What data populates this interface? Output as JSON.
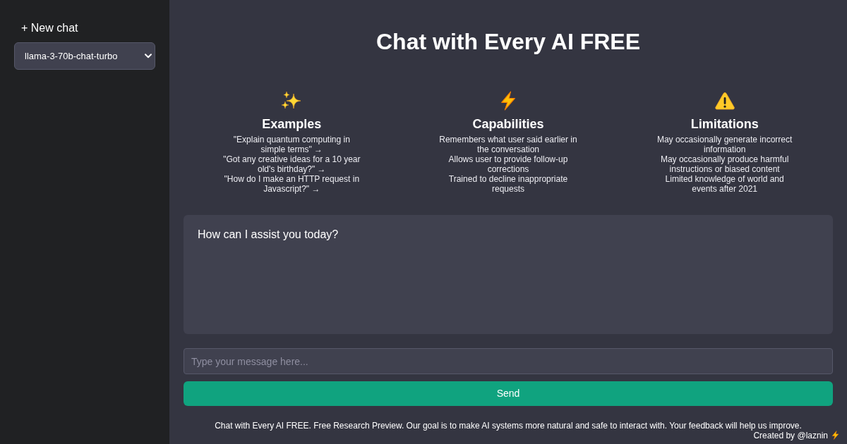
{
  "sidebar": {
    "new_chat_button": "+ New chat",
    "model_select": {
      "value": "llama-3-70b-chat-turbo"
    }
  },
  "main": {
    "title": "Chat with Every AI FREE",
    "columns": [
      {
        "kind": "sparkles",
        "heading": "Examples",
        "items": [
          "\"Explain quantum computing in simple terms\" →",
          "\"Got any creative ideas for a 10 year old's birthday?\" →",
          "\"How do I make an HTTP request in Javascript?\" →"
        ]
      },
      {
        "kind": "bolt",
        "heading": "Capabilities",
        "items": [
          "Remembers what user said earlier in the conversation",
          "Allows user to provide follow-up corrections",
          "Trained to decline inappropriate requests"
        ]
      },
      {
        "kind": "warning",
        "heading": "Limitations",
        "items": [
          "May occasionally generate incorrect information",
          "May occasionally produce harmful instructions or biased content",
          "Limited knowledge of world and events after 2021"
        ]
      }
    ],
    "chat": {
      "messages": [
        "How can I assist you today?"
      ]
    },
    "input": {
      "placeholder": "Type your message here..."
    },
    "send_button": "Send",
    "footer": "Chat with Every AI FREE. Free Research Preview. Our goal is to make AI systems more natural and safe to interact with. Your feedback will help us improve."
  },
  "credit": {
    "text": "Created by @laznin"
  }
}
